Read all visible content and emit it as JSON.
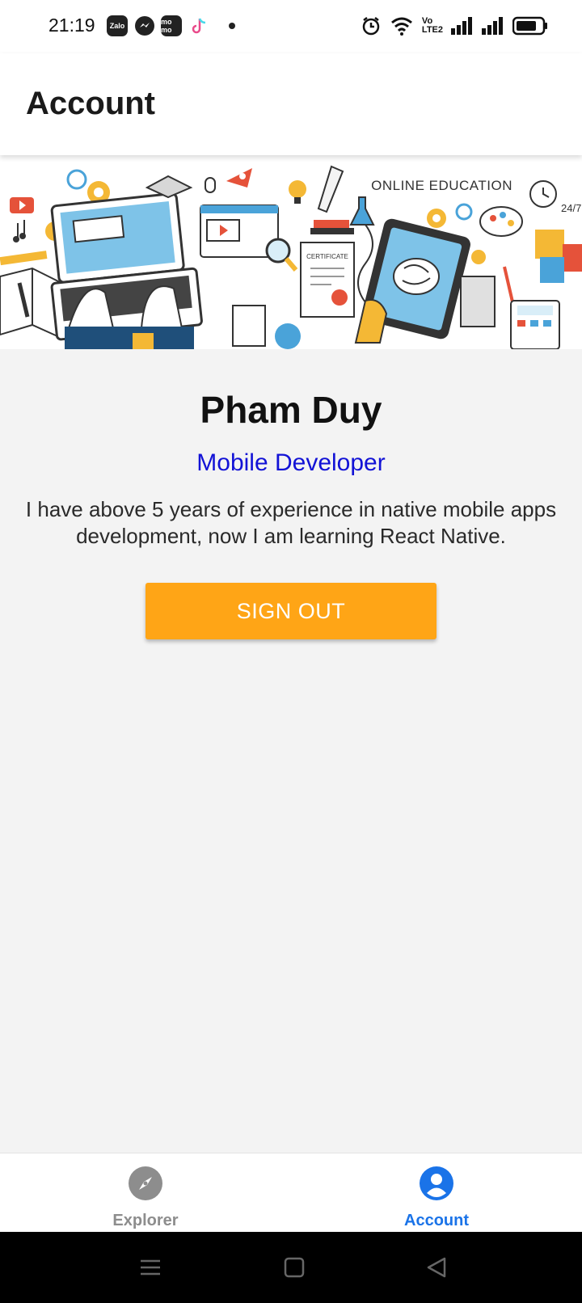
{
  "status_bar": {
    "time": "21:19",
    "apps": [
      "Zalo",
      "messenger-icon",
      "mo mo",
      "tiktok-icon"
    ],
    "indicators": [
      "alarm-icon",
      "wifi-icon",
      "volte-icon",
      "signal-icon",
      "signal-icon",
      "battery-icon"
    ]
  },
  "header": {
    "title": "Account"
  },
  "banner": {
    "caption": "ONLINE EDUCATION",
    "certificate_text": "CERTIFICATE",
    "clock_text": "24/7"
  },
  "profile": {
    "name": "Pham Duy",
    "role": "Mobile Developer",
    "bio": "I have above 5 years of experience in native mobile apps development, now I am learning React Native."
  },
  "actions": {
    "sign_out_label": "SIGN OUT"
  },
  "tabs": [
    {
      "label": "Explorer",
      "icon": "compass-icon",
      "active": false
    },
    {
      "label": "Account",
      "icon": "account-icon",
      "active": true
    }
  ],
  "colors": {
    "accent_orange": "#ffa516",
    "active_tab": "#1a73e8",
    "inactive_tab": "#8d8d8d",
    "role_text": "#1212d6"
  }
}
